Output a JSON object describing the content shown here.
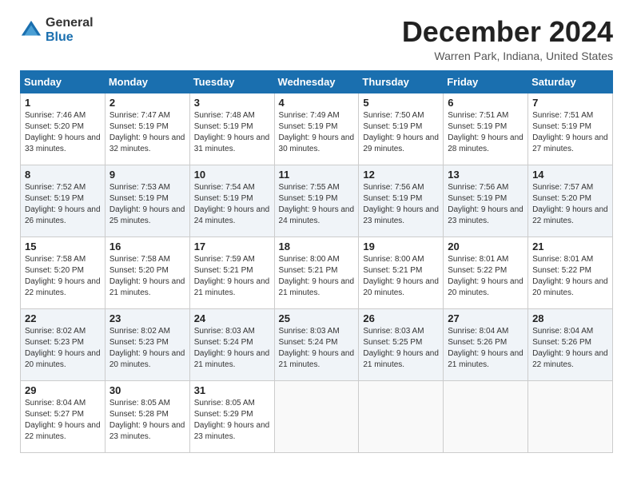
{
  "logo": {
    "general": "General",
    "blue": "Blue"
  },
  "title": "December 2024",
  "location": "Warren Park, Indiana, United States",
  "weekdays": [
    "Sunday",
    "Monday",
    "Tuesday",
    "Wednesday",
    "Thursday",
    "Friday",
    "Saturday"
  ],
  "weeks": [
    [
      {
        "day": "1",
        "sunrise": "7:46 AM",
        "sunset": "5:20 PM",
        "daylight": "9 hours and 33 minutes."
      },
      {
        "day": "2",
        "sunrise": "7:47 AM",
        "sunset": "5:19 PM",
        "daylight": "9 hours and 32 minutes."
      },
      {
        "day": "3",
        "sunrise": "7:48 AM",
        "sunset": "5:19 PM",
        "daylight": "9 hours and 31 minutes."
      },
      {
        "day": "4",
        "sunrise": "7:49 AM",
        "sunset": "5:19 PM",
        "daylight": "9 hours and 30 minutes."
      },
      {
        "day": "5",
        "sunrise": "7:50 AM",
        "sunset": "5:19 PM",
        "daylight": "9 hours and 29 minutes."
      },
      {
        "day": "6",
        "sunrise": "7:51 AM",
        "sunset": "5:19 PM",
        "daylight": "9 hours and 28 minutes."
      },
      {
        "day": "7",
        "sunrise": "7:51 AM",
        "sunset": "5:19 PM",
        "daylight": "9 hours and 27 minutes."
      }
    ],
    [
      {
        "day": "8",
        "sunrise": "7:52 AM",
        "sunset": "5:19 PM",
        "daylight": "9 hours and 26 minutes."
      },
      {
        "day": "9",
        "sunrise": "7:53 AM",
        "sunset": "5:19 PM",
        "daylight": "9 hours and 25 minutes."
      },
      {
        "day": "10",
        "sunrise": "7:54 AM",
        "sunset": "5:19 PM",
        "daylight": "9 hours and 24 minutes."
      },
      {
        "day": "11",
        "sunrise": "7:55 AM",
        "sunset": "5:19 PM",
        "daylight": "9 hours and 24 minutes."
      },
      {
        "day": "12",
        "sunrise": "7:56 AM",
        "sunset": "5:19 PM",
        "daylight": "9 hours and 23 minutes."
      },
      {
        "day": "13",
        "sunrise": "7:56 AM",
        "sunset": "5:19 PM",
        "daylight": "9 hours and 23 minutes."
      },
      {
        "day": "14",
        "sunrise": "7:57 AM",
        "sunset": "5:20 PM",
        "daylight": "9 hours and 22 minutes."
      }
    ],
    [
      {
        "day": "15",
        "sunrise": "7:58 AM",
        "sunset": "5:20 PM",
        "daylight": "9 hours and 22 minutes."
      },
      {
        "day": "16",
        "sunrise": "7:58 AM",
        "sunset": "5:20 PM",
        "daylight": "9 hours and 21 minutes."
      },
      {
        "day": "17",
        "sunrise": "7:59 AM",
        "sunset": "5:21 PM",
        "daylight": "9 hours and 21 minutes."
      },
      {
        "day": "18",
        "sunrise": "8:00 AM",
        "sunset": "5:21 PM",
        "daylight": "9 hours and 21 minutes."
      },
      {
        "day": "19",
        "sunrise": "8:00 AM",
        "sunset": "5:21 PM",
        "daylight": "9 hours and 20 minutes."
      },
      {
        "day": "20",
        "sunrise": "8:01 AM",
        "sunset": "5:22 PM",
        "daylight": "9 hours and 20 minutes."
      },
      {
        "day": "21",
        "sunrise": "8:01 AM",
        "sunset": "5:22 PM",
        "daylight": "9 hours and 20 minutes."
      }
    ],
    [
      {
        "day": "22",
        "sunrise": "8:02 AM",
        "sunset": "5:23 PM",
        "daylight": "9 hours and 20 minutes."
      },
      {
        "day": "23",
        "sunrise": "8:02 AM",
        "sunset": "5:23 PM",
        "daylight": "9 hours and 20 minutes."
      },
      {
        "day": "24",
        "sunrise": "8:03 AM",
        "sunset": "5:24 PM",
        "daylight": "9 hours and 21 minutes."
      },
      {
        "day": "25",
        "sunrise": "8:03 AM",
        "sunset": "5:24 PM",
        "daylight": "9 hours and 21 minutes."
      },
      {
        "day": "26",
        "sunrise": "8:03 AM",
        "sunset": "5:25 PM",
        "daylight": "9 hours and 21 minutes."
      },
      {
        "day": "27",
        "sunrise": "8:04 AM",
        "sunset": "5:26 PM",
        "daylight": "9 hours and 21 minutes."
      },
      {
        "day": "28",
        "sunrise": "8:04 AM",
        "sunset": "5:26 PM",
        "daylight": "9 hours and 22 minutes."
      }
    ],
    [
      {
        "day": "29",
        "sunrise": "8:04 AM",
        "sunset": "5:27 PM",
        "daylight": "9 hours and 22 minutes."
      },
      {
        "day": "30",
        "sunrise": "8:05 AM",
        "sunset": "5:28 PM",
        "daylight": "9 hours and 23 minutes."
      },
      {
        "day": "31",
        "sunrise": "8:05 AM",
        "sunset": "5:29 PM",
        "daylight": "9 hours and 23 minutes."
      },
      null,
      null,
      null,
      null
    ]
  ]
}
